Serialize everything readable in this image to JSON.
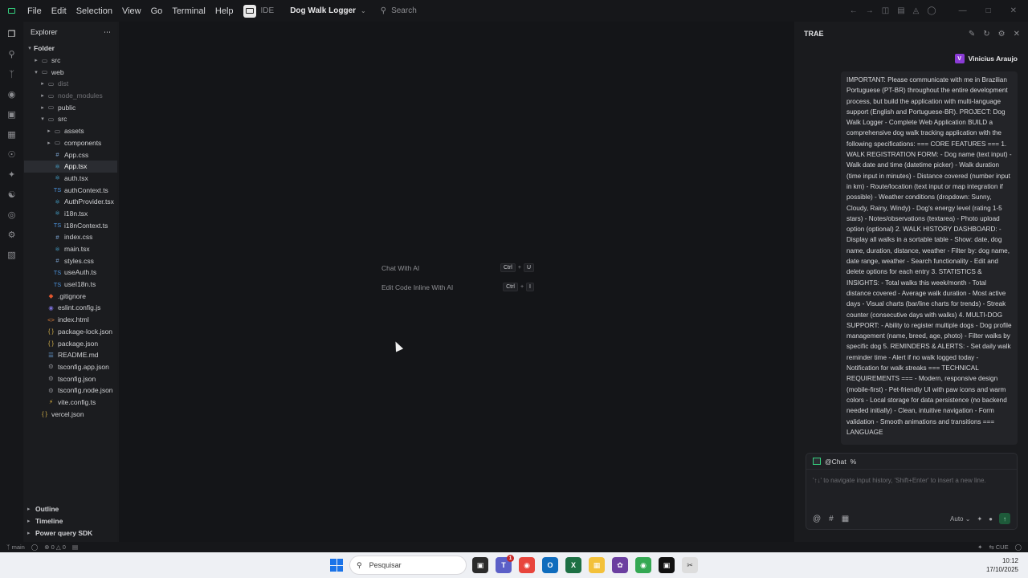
{
  "titlebar": {
    "menu": [
      "File",
      "Edit",
      "Selection",
      "View",
      "Go",
      "Terminal",
      "Help"
    ],
    "ide_label": "IDE",
    "project_name": "Dog Walk Logger",
    "search_placeholder": "Search"
  },
  "explorer": {
    "title": "Explorer",
    "items": [
      {
        "label": "Folder",
        "indent": 0,
        "type": "folder-root",
        "open": true
      },
      {
        "label": "src",
        "indent": 1,
        "type": "folder",
        "open": false
      },
      {
        "label": "web",
        "indent": 1,
        "type": "folder",
        "open": true
      },
      {
        "label": "dist",
        "indent": 2,
        "type": "folder",
        "open": false,
        "dim": true
      },
      {
        "label": "node_modules",
        "indent": 2,
        "type": "folder",
        "open": false,
        "dim": true
      },
      {
        "label": "public",
        "indent": 2,
        "type": "folder",
        "open": false
      },
      {
        "label": "src",
        "indent": 2,
        "type": "folder",
        "open": true
      },
      {
        "label": "assets",
        "indent": 3,
        "type": "folder",
        "open": false
      },
      {
        "label": "components",
        "indent": 3,
        "type": "folder",
        "open": false
      },
      {
        "label": "App.css",
        "indent": 3,
        "type": "css"
      },
      {
        "label": "App.tsx",
        "indent": 3,
        "type": "tsx",
        "selected": true
      },
      {
        "label": "auth.tsx",
        "indent": 3,
        "type": "tsx"
      },
      {
        "label": "authContext.ts",
        "indent": 3,
        "type": "ts"
      },
      {
        "label": "AuthProvider.tsx",
        "indent": 3,
        "type": "tsx"
      },
      {
        "label": "i18n.tsx",
        "indent": 3,
        "type": "tsx"
      },
      {
        "label": "i18nContext.ts",
        "indent": 3,
        "type": "ts"
      },
      {
        "label": "index.css",
        "indent": 3,
        "type": "css"
      },
      {
        "label": "main.tsx",
        "indent": 3,
        "type": "tsx"
      },
      {
        "label": "styles.css",
        "indent": 3,
        "type": "css"
      },
      {
        "label": "useAuth.ts",
        "indent": 3,
        "type": "ts"
      },
      {
        "label": "useI18n.ts",
        "indent": 3,
        "type": "ts"
      },
      {
        "label": ".gitignore",
        "indent": 2,
        "type": "git"
      },
      {
        "label": "eslint.config.js",
        "indent": 2,
        "type": "eslint"
      },
      {
        "label": "index.html",
        "indent": 2,
        "type": "html"
      },
      {
        "label": "package-lock.json",
        "indent": 2,
        "type": "json"
      },
      {
        "label": "package.json",
        "indent": 2,
        "type": "json"
      },
      {
        "label": "README.md",
        "indent": 2,
        "type": "md"
      },
      {
        "label": "tsconfig.app.json",
        "indent": 2,
        "type": "tsconfig"
      },
      {
        "label": "tsconfig.json",
        "indent": 2,
        "type": "tsconfig"
      },
      {
        "label": "tsconfig.node.json",
        "indent": 2,
        "type": "tsconfig"
      },
      {
        "label": "vite.config.ts",
        "indent": 2,
        "type": "vite"
      },
      {
        "label": "vercel.json",
        "indent": 1,
        "type": "json"
      }
    ],
    "sections": [
      "Outline",
      "Timeline",
      "Power query SDK"
    ]
  },
  "editor": {
    "shortcuts": [
      {
        "label": "Chat With AI",
        "keys": [
          "Ctrl",
          "U"
        ]
      },
      {
        "label": "Edit Code Inline With AI",
        "keys": [
          "Ctrl",
          "I"
        ]
      }
    ]
  },
  "chat": {
    "title": "TRAE",
    "user_name": "Vinicius Araujo",
    "user_initial": "V",
    "message": "IMPORTANT: Please communicate with me in Brazilian Portuguese (PT-BR) throughout the entire development process, but build the application with multi-language support (English and Portuguese-BR). PROJECT: Dog Walk Logger - Complete Web Application BUILD a comprehensive dog walk tracking application with the following specifications: === CORE FEATURES === 1. WALK REGISTRATION FORM: - Dog name (text input) - Walk date and time (datetime picker) - Walk duration (time input in minutes) - Distance covered (number input in km) - Route/location (text input or map integration if possible) - Weather conditions (dropdown: Sunny, Cloudy, Rainy, Windy) - Dog's energy level (rating 1-5 stars) - Notes/observations (textarea) - Photo upload option (optional) 2. WALK HISTORY DASHBOARD: - Display all walks in a sortable table - Show: date, dog name, duration, distance, weather - Filter by: dog name, date range, weather - Search functionality - Edit and delete options for each entry 3. STATISTICS & INSIGHTS: - Total walks this week/month - Total distance covered - Average walk duration - Most active days - Visual charts (bar/line charts for trends) - Streak counter (consecutive days with walks) 4. MULTI-DOG SUPPORT: - Ability to register multiple dogs - Dog profile management (name, breed, age, photo) - Filter walks by specific dog 5. REMINDERS & ALERTS: - Set daily walk reminder time - Alert if no walk logged today - Notification for walk streaks === TECHNICAL REQUIREMENTS === - Modern, responsive design (mobile-first) - Pet-friendly UI with paw icons and warm colors - Local storage for data persistence (no backend needed initially) - Clean, intuitive navigation - Form validation - Smooth animations and transitions === LANGUAGE",
    "input_mention": "@Chat",
    "input_placeholder": "'↑↓' to navigate input history, 'Shift+Enter' to insert a new line.",
    "mode": "Auto"
  },
  "statusbar": {
    "branch": "main",
    "errors": "0",
    "warnings": "0",
    "right_label": "CUE"
  },
  "taskbar": {
    "search_placeholder": "Pesquisar",
    "time": "10:12",
    "date": "17/10/2025",
    "teams_badge": "1"
  }
}
